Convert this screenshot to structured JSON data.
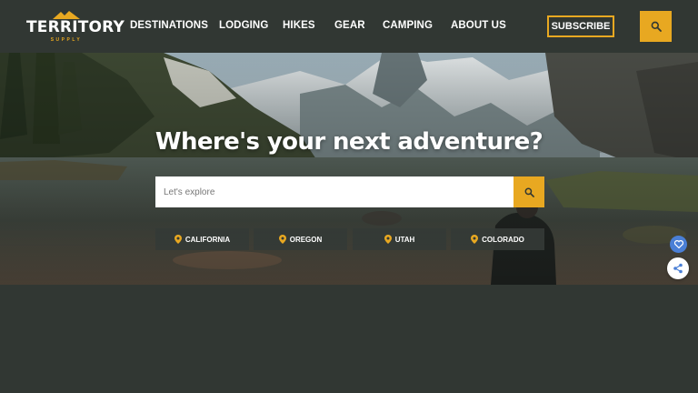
{
  "brand": {
    "name": "TERRITORY",
    "tagline": "SUPPLY"
  },
  "nav": {
    "items": [
      "DESTINATIONS",
      "LODGING",
      "HIKES",
      "GEAR",
      "CAMPING",
      "ABOUT US"
    ]
  },
  "header": {
    "subscribe_label": "SUBSCRIBE",
    "search_icon": "search-icon"
  },
  "hero": {
    "headline": "Where's your next adventure?",
    "search_placeholder": "Let's explore",
    "destinations": [
      "CALIFORNIA",
      "OREGON",
      "UTAH",
      "COLORADO"
    ]
  },
  "colors": {
    "accent": "#e8a821",
    "background": "#313733",
    "favorite": "#4a7fd6"
  }
}
